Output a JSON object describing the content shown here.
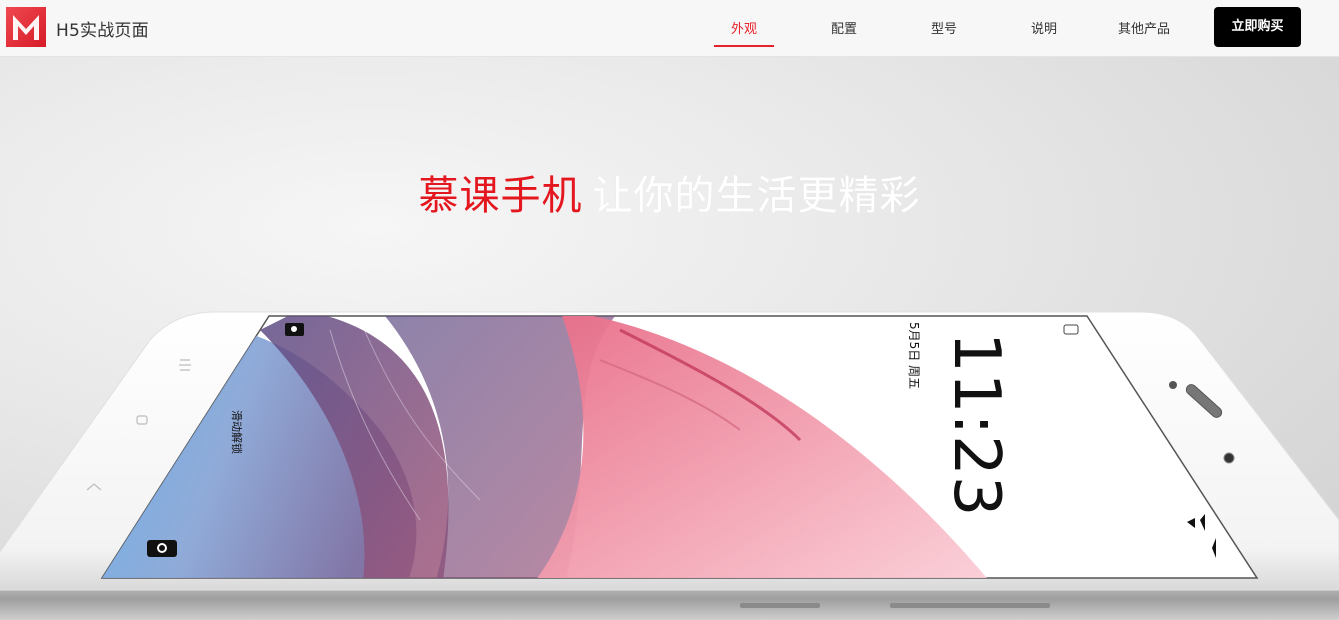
{
  "header": {
    "logo_icon": "m-logo-icon",
    "brand": "H5实战页面",
    "nav": [
      {
        "label": "外观",
        "active": true
      },
      {
        "label": "配置",
        "active": false
      },
      {
        "label": "型号",
        "active": false
      },
      {
        "label": "说明",
        "active": false
      },
      {
        "label": "其他产品",
        "active": false
      }
    ],
    "buy_label": "立即购买"
  },
  "hero": {
    "headline_red": "慕课手机",
    "headline_white": "让你的生活更精彩",
    "phone_screen": {
      "clock": "11:23",
      "date_text": "5月5日 周五",
      "lock_text": "滑动解锁"
    }
  },
  "colors": {
    "accent_red": "#e4161e",
    "buy_button_bg": "#000000",
    "header_bg": "#f7f7f7"
  }
}
